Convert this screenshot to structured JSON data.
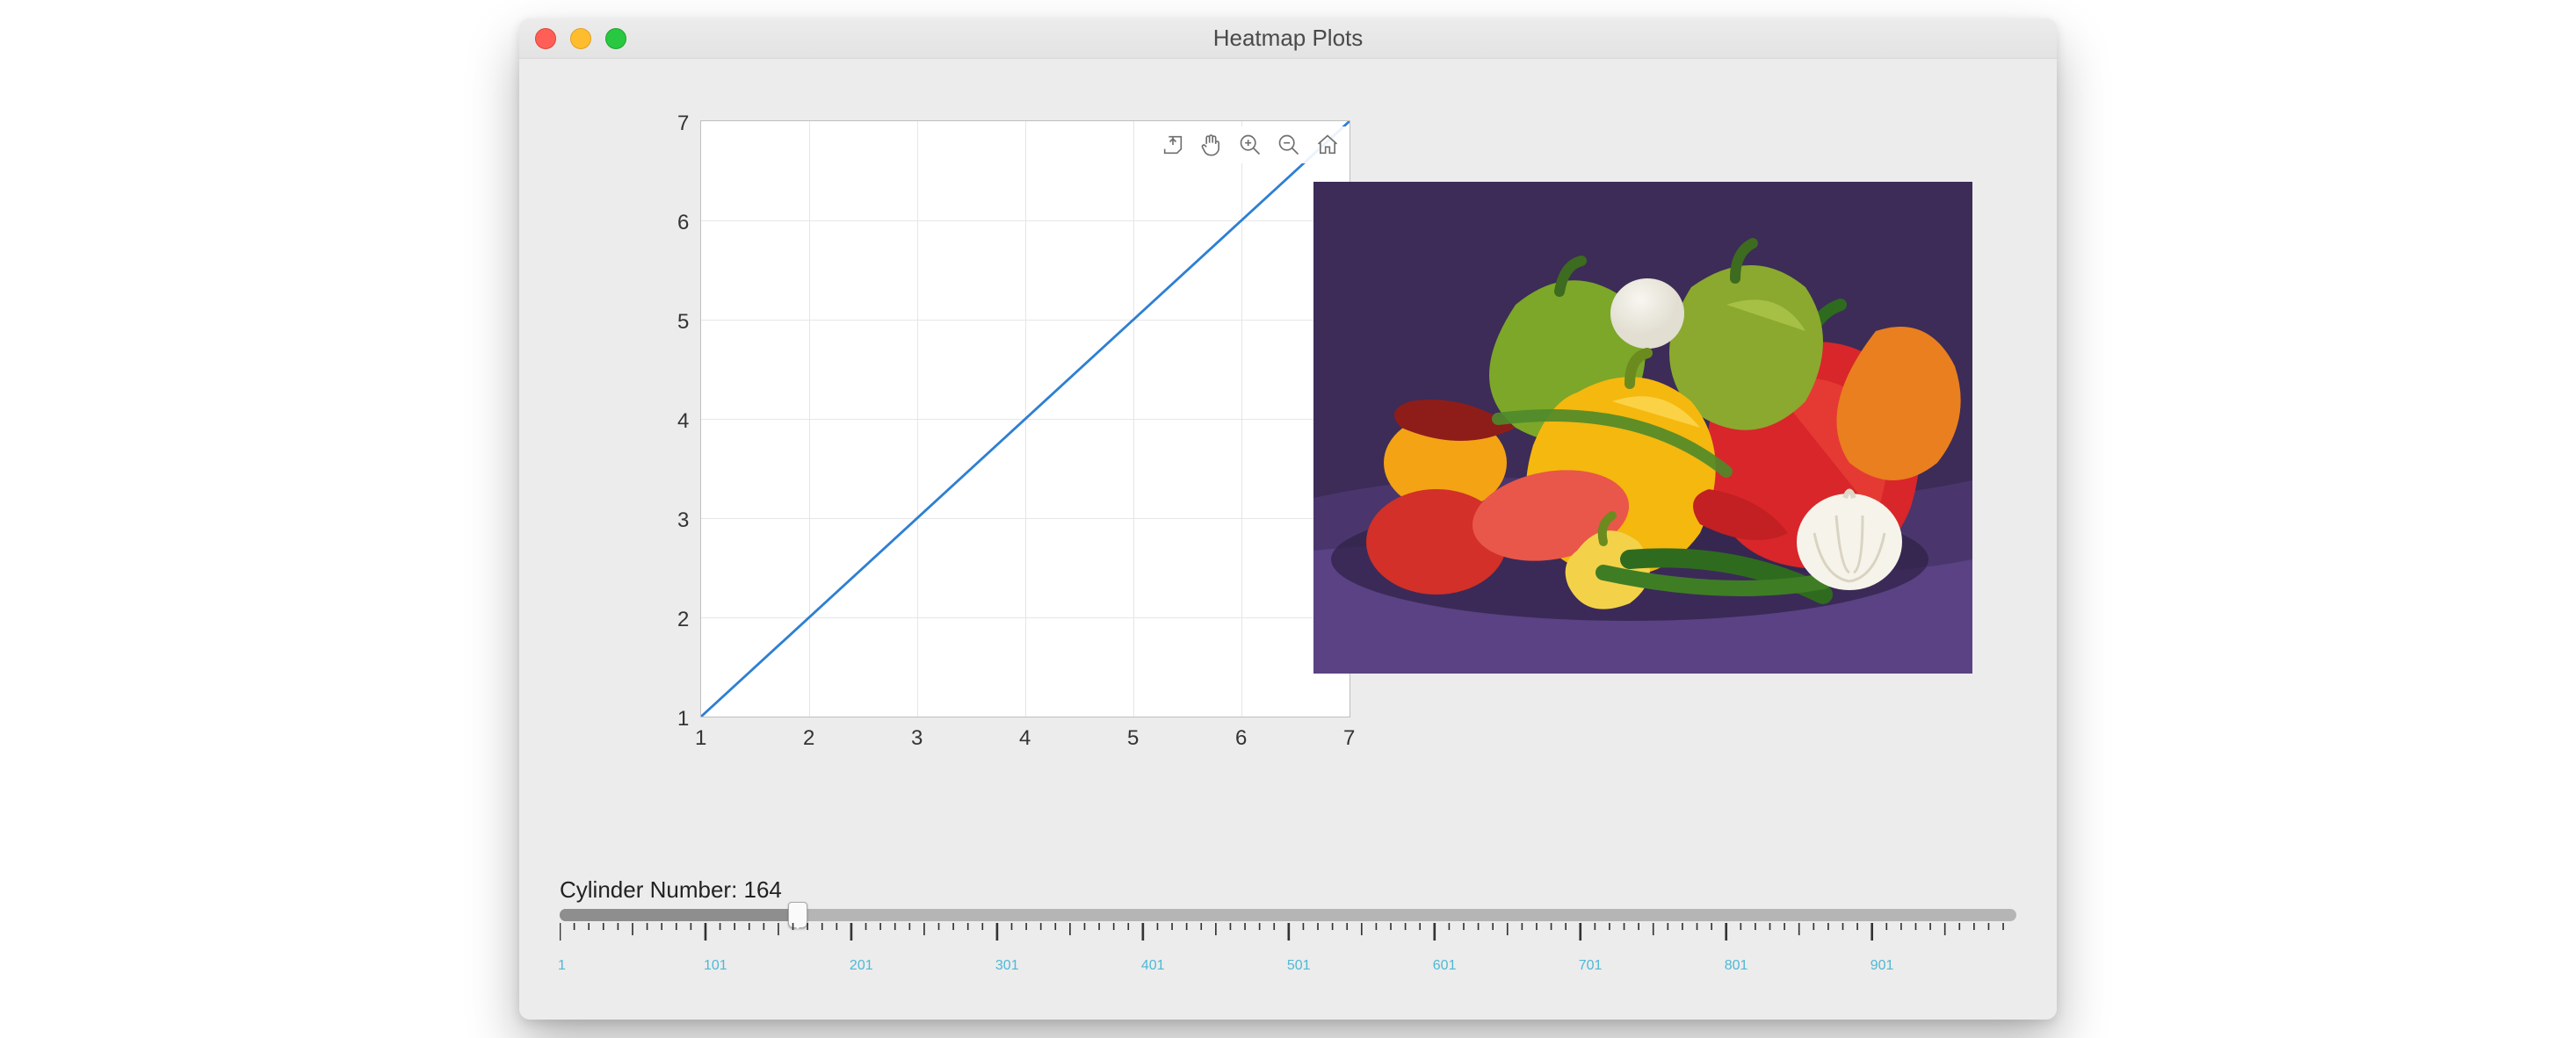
{
  "window": {
    "title": "Heatmap Plots"
  },
  "chart_data": {
    "type": "line",
    "x": [
      1,
      2,
      3,
      4,
      5,
      6,
      7
    ],
    "y": [
      1,
      2,
      3,
      4,
      5,
      6,
      7
    ],
    "xlim": [
      1,
      7
    ],
    "ylim": [
      1,
      7
    ],
    "xticks": [
      1,
      2,
      3,
      4,
      5,
      6,
      7
    ],
    "yticks": [
      1,
      2,
      3,
      4,
      5,
      6,
      7
    ],
    "grid": true,
    "line_color": "#2d7fd3",
    "toolbar": [
      "export",
      "pan",
      "zoom-in",
      "zoom-out",
      "home"
    ]
  },
  "image_panel": {
    "description": "peppers photograph"
  },
  "slider": {
    "label_prefix": "Cylinder Number: ",
    "value": 164,
    "min": 1,
    "max": 1000,
    "major_tick_interval": 100,
    "tick_labels": [
      "1",
      "101",
      "201",
      "301",
      "401",
      "501",
      "601",
      "701",
      "801",
      "901"
    ]
  },
  "axis_labels": {
    "x": [
      "1",
      "2",
      "3",
      "4",
      "5",
      "6",
      "7"
    ],
    "y": [
      "1",
      "2",
      "3",
      "4",
      "5",
      "6",
      "7"
    ]
  }
}
